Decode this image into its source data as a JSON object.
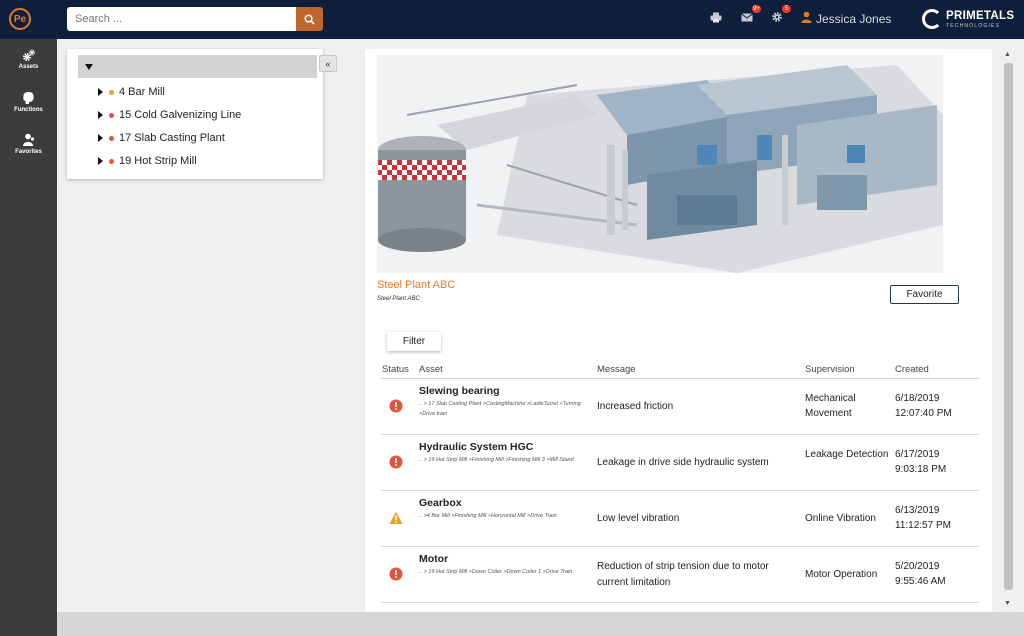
{
  "header": {
    "logo_text": "Pe",
    "search_placeholder": "Search ...",
    "mail_badge": "9+",
    "settings_badge": "5",
    "user_name": "Jessica Jones",
    "brand_name": "PRIMETALS",
    "brand_sub": "TECHNOLOGIES"
  },
  "nav": {
    "items": [
      {
        "label": "Assets"
      },
      {
        "label": "Functions"
      },
      {
        "label": "Favorites"
      }
    ]
  },
  "tree": {
    "collapse_label": "«",
    "items": [
      {
        "label": "4 Bar Mill",
        "color": "#e8a21f"
      },
      {
        "label": "15 Cold Galvenizing Line",
        "color": "#e5533c"
      },
      {
        "label": "17 Slab Casting Plant",
        "color": "#e5533c"
      },
      {
        "label": "19 Hot Strip Mill",
        "color": "#e5533c"
      }
    ]
  },
  "plant": {
    "title": "Steel Plant ABC",
    "subtitle": "Steel Plant ABC",
    "favorite_label": "Favorite"
  },
  "filter_label": "Filter",
  "table": {
    "headers": {
      "status": "Status",
      "asset": "Asset",
      "message": "Message",
      "supervision": "Supervision",
      "created": "Created"
    },
    "rows": [
      {
        "status": "error",
        "asset": "Slewing bearing",
        "path": ".. > 17 Slab Casting Plant >CastingMachine >LadleTurret >Turning >Drive train",
        "message": "Increased friction",
        "supervision": "Mechanical Movement",
        "created_date": "6/18/2019",
        "created_time": "12:07:40 PM"
      },
      {
        "status": "error",
        "asset": "Hydraulic System HGC",
        "path": ".. > 19 Hot Strip Mill >Finishing Mill >Finishing Mill 3 >Mill Stand",
        "message": "Leakage in drive side hydraulic system",
        "supervision": "Leakage Detection",
        "created_date": "6/17/2019",
        "created_time": "9:03:18 PM"
      },
      {
        "status": "warning",
        "asset": "Gearbox",
        "path": ".. >4 Bar Mill >Finishing Mill >Horizontal Mill >Drive Train",
        "message": "Low level vibration",
        "supervision": "Online Vibration",
        "created_date": "6/13/2019",
        "created_time": "11:12:57 PM"
      },
      {
        "status": "error",
        "asset": "Motor",
        "path": ".. > 19 Hot Strip Mill >Down Coiler >Down Coiler 1 >Drive Train",
        "message": "Reduction of strip tension due to motor current limitation",
        "supervision": "Motor Operation",
        "created_date": "5/20/2019",
        "created_time": "9:55:46 AM"
      }
    ]
  },
  "colors": {
    "header_bg": "#0e1f3b",
    "accent": "#e07b2a",
    "error": "#e5533c",
    "warning": "#e8a21f"
  }
}
